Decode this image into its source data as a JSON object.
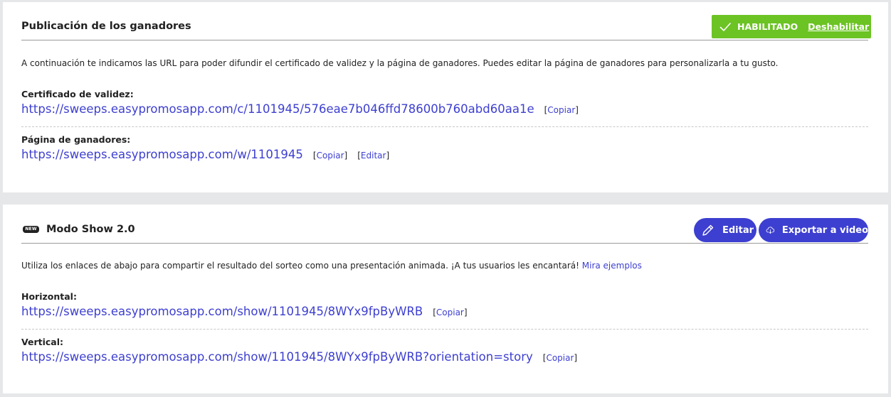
{
  "winners": {
    "title": "Publicación de los ganadores",
    "status_text": "HABILITADO",
    "disable_label": "Deshabilitar",
    "description": "A continuación te indicamos las URL para poder difundir el certificado de validez y la página de ganadores. Puedes editar la página de ganadores para personalizarla a tu gusto.",
    "certificate": {
      "label": "Certificado de validez:",
      "url": "https://sweeps.easypromosapp.com/c/1101945/576eae7b046ffd78600b760abd60aa1e",
      "copy_label": "Copiar"
    },
    "winners_page": {
      "label": "Página de ganadores:",
      "url": "https://sweeps.easypromosapp.com/w/1101945",
      "copy_label": "Copiar",
      "edit_label": "Editar"
    }
  },
  "show": {
    "badge": "NEW",
    "title": "Modo Show 2.0",
    "edit_label": "Editar",
    "export_label": "Exportar a video",
    "description": "Utiliza los enlaces de abajo para compartir el resultado del sorteo como una presentación animada. ¡A tus usuarios les encantará!",
    "examples_link": "Mira ejemplos",
    "horizontal": {
      "label": "Horizontal:",
      "url": "https://sweeps.easypromosapp.com/show/1101945/8WYx9fpByWRB",
      "copy_label": "Copiar"
    },
    "vertical": {
      "label": "Vertical:",
      "url": "https://sweeps.easypromosapp.com/show/1101945/8WYx9fpByWRB?orientation=story",
      "copy_label": "Copiar"
    }
  },
  "colors": {
    "accent": "#3d3fd0",
    "success": "#6cc324",
    "background": "#e6e7e8"
  },
  "icons": {
    "status": "check-icon",
    "edit": "pencil-icon",
    "export": "cloud-upload-icon"
  }
}
